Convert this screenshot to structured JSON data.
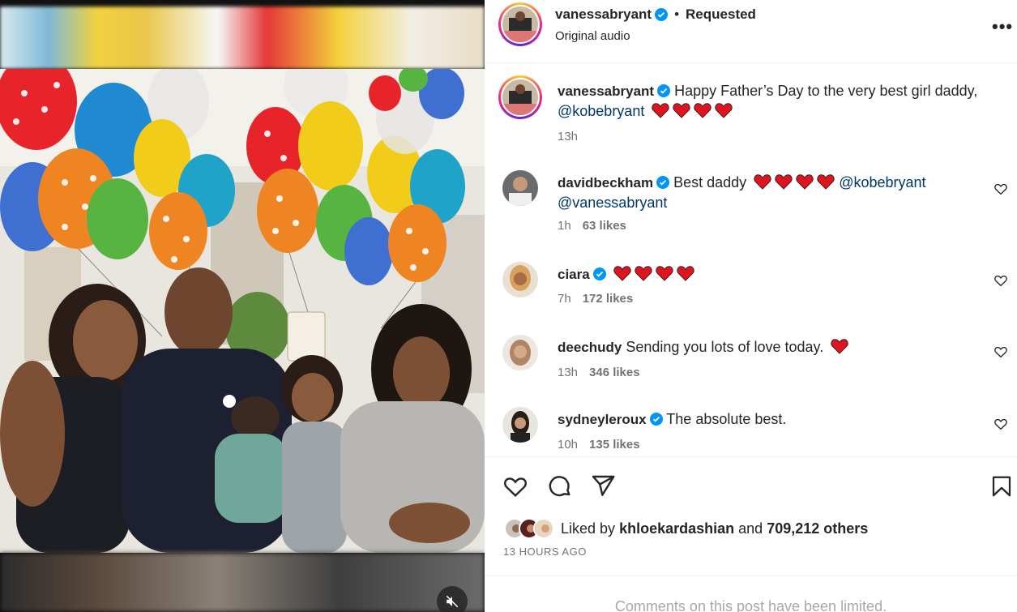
{
  "post": {
    "author": "vanessabryant",
    "follow_status": "Requested",
    "audio": "Original audio",
    "more_label": "•••",
    "caption": {
      "username": "vanessabryant",
      "text": "Happy Father’s Day to the very best girl daddy,",
      "mention": "@kobebryant",
      "hearts": 4,
      "time": "13h"
    },
    "comments": [
      {
        "username": "davidbeckham",
        "verified": true,
        "text": "Best daddy",
        "hearts": 4,
        "mention1": "@kobebryant",
        "mention2": "@vanessabryant",
        "time": "1h",
        "likes": "63 likes"
      },
      {
        "username": "ciara",
        "verified": true,
        "text": "",
        "hearts": 4,
        "time": "7h",
        "likes": "172 likes"
      },
      {
        "username": "deechudy",
        "verified": false,
        "text": "Sending you lots of love today.",
        "hearts": 1,
        "time": "13h",
        "likes": "346 likes"
      },
      {
        "username": "sydneyleroux",
        "verified": true,
        "text": "The absolute best.",
        "hearts": 0,
        "time": "10h",
        "likes": "135 likes"
      }
    ],
    "likes": {
      "prefix": "Liked by",
      "user": "khloekardashian",
      "and": "and",
      "count": "709,212 others"
    },
    "posted": "13 HOURS AGO",
    "comments_limited": "Comments on this post have been limited."
  },
  "icons": {
    "verified": "verified-badge-icon",
    "heart": "heart-icon",
    "comment": "comment-icon",
    "share": "share-icon",
    "save": "bookmark-icon",
    "mute": "muted-speaker-icon",
    "more": "more-options-icon"
  },
  "colors": {
    "verified": "#0095f6",
    "mention": "#00376b",
    "heart_emoji": "#e0141e"
  }
}
